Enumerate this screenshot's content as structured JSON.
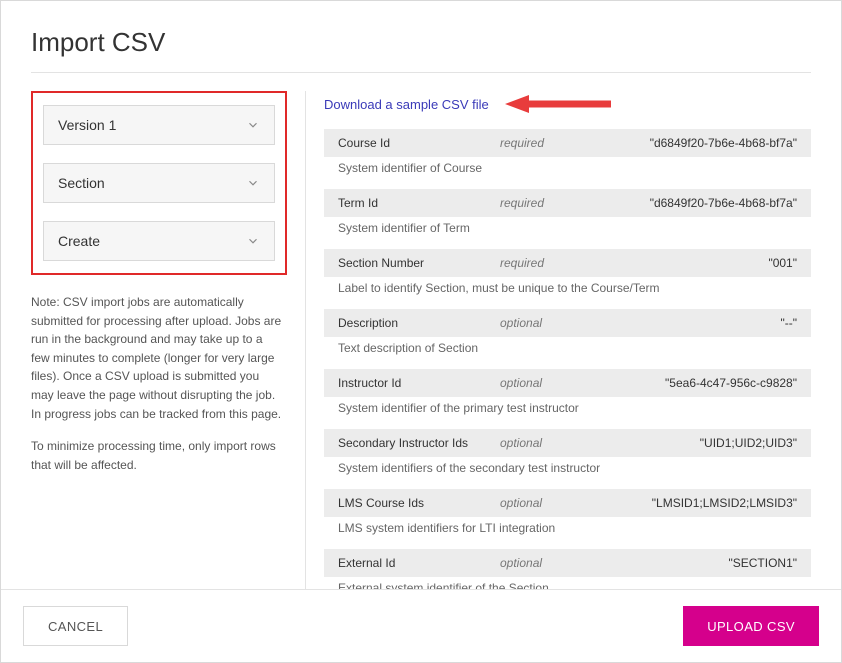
{
  "title": "Import CSV",
  "dropdowns": [
    {
      "label": "Version 1"
    },
    {
      "label": "Section"
    },
    {
      "label": "Create"
    }
  ],
  "notes": [
    "Note: CSV import jobs are automatically submitted for processing after upload. Jobs are run in the background and may take up to a few minutes to complete (longer for very large files). Once a CSV upload is submitted you may leave the page without disrupting the job. In progress jobs can be tracked from this page.",
    "To minimize processing time, only import rows that will be affected."
  ],
  "sample_link": "Download a sample CSV file",
  "fields": [
    {
      "name": "Course Id",
      "req": "required",
      "example": "\"d6849f20-7b6e-4b68-bf7a\"",
      "desc": "System identifier of Course"
    },
    {
      "name": "Term Id",
      "req": "required",
      "example": "\"d6849f20-7b6e-4b68-bf7a\"",
      "desc": "System identifier of Term"
    },
    {
      "name": "Section Number",
      "req": "required",
      "example": "\"001\"",
      "desc": "Label to identify Section, must be unique to the Course/Term"
    },
    {
      "name": "Description",
      "req": "optional",
      "example": "\"--\"",
      "desc": "Text description of Section"
    },
    {
      "name": "Instructor Id",
      "req": "optional",
      "example": "\"5ea6-4c47-956c-c9828\"",
      "desc": "System identifier of the primary test instructor"
    },
    {
      "name": "Secondary Instructor Ids",
      "req": "optional",
      "example": "\"UID1;UID2;UID3\"",
      "desc": "System identifiers of the secondary test instructor"
    },
    {
      "name": "LMS Course Ids",
      "req": "optional",
      "example": "\"LMSID1;LMSID2;LMSID3\"",
      "desc": "LMS system identifiers for LTI integration"
    },
    {
      "name": "External Id",
      "req": "optional",
      "example": "\"SECTION1\"",
      "desc": "External system identifier of the Section"
    }
  ],
  "buttons": {
    "cancel": "CANCEL",
    "upload": "UPLOAD CSV"
  }
}
